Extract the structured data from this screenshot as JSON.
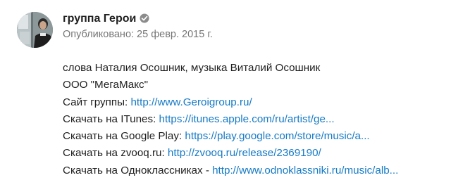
{
  "channel": {
    "name": "группа Герои",
    "verified_icon": "verified-check-icon",
    "published": "Опубликовано: 25 февр. 2015 г.",
    "avatar_icon": "channel-avatar-photo"
  },
  "description": {
    "line1": "слова Наталия Осошник, музыка Виталий Осошник",
    "line2": "ООО \"МегаМакс\"",
    "links": [
      {
        "label": "Сайт группы: ",
        "url": "http://www.Geroigroup.ru/"
      },
      {
        "label": "Скачать на ITunes: ",
        "url": "https://itunes.apple.com/ru/artist/ge..."
      },
      {
        "label": "Скачать на Google Play: ",
        "url": "https://play.google.com/store/music/a..."
      },
      {
        "label": "Скачать на zvooq.ru: ",
        "url": "http://zvooq.ru/release/2369190/"
      },
      {
        "label": "Скачать на Одноклассниках - ",
        "url": "http://www.odnoklassniki.ru/music/alb..."
      }
    ]
  },
  "colors": {
    "link": "#167ac6",
    "secondary_text": "#767676",
    "verified_icon": "#8c8c8c"
  }
}
